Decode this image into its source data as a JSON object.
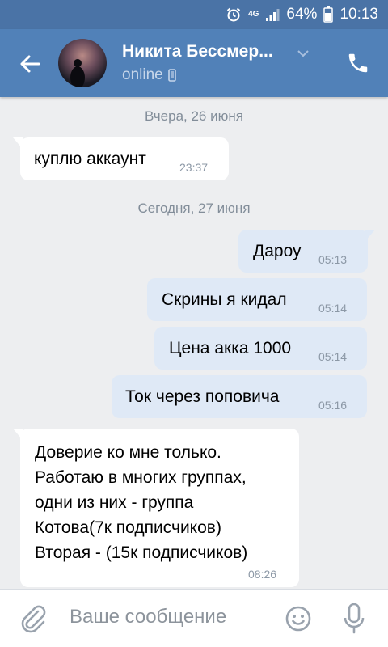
{
  "status_bar": {
    "network": "4G",
    "battery": "64%",
    "time": "10:13"
  },
  "header": {
    "contact_name": "Никита Бессмер...",
    "status": "online"
  },
  "messages": [
    {
      "kind": "date",
      "text": "Вчера, 26 июня"
    },
    {
      "kind": "incoming",
      "text": "куплю аккаунт",
      "time": "23:37"
    },
    {
      "kind": "date",
      "text": "Сегодня, 27 июня"
    },
    {
      "kind": "outgoing",
      "text": "Дароу",
      "time": "05:13"
    },
    {
      "kind": "outgoing",
      "text": "Скрины я кидал",
      "time": "05:14"
    },
    {
      "kind": "outgoing",
      "text": "Цена акка 1000",
      "time": "05:14"
    },
    {
      "kind": "outgoing",
      "text": "Ток через поповича",
      "time": "05:16"
    },
    {
      "kind": "incoming",
      "lines": [
        "Доверие ко мне только.",
        "Работаю в многих группах,",
        "одни из них - группа",
        "Котова(7к подписчиков)",
        "Вторая - (15к подписчиков)"
      ],
      "time": "08:26"
    }
  ],
  "composer": {
    "placeholder": "Ваше сообщение"
  },
  "colors": {
    "header": "#5181b8",
    "status_bar": "#4a73a6",
    "chat_background": "#edeef0",
    "outgoing_bubble": "#dfe9f6",
    "incoming_bubble": "#ffffff"
  },
  "icons": [
    "alarm-icon",
    "signal-icon",
    "battery-icon",
    "back-arrow-icon",
    "chevron-down-icon",
    "phone-icon",
    "mobile-icon",
    "paperclip-icon",
    "emoji-icon",
    "microphone-icon"
  ]
}
